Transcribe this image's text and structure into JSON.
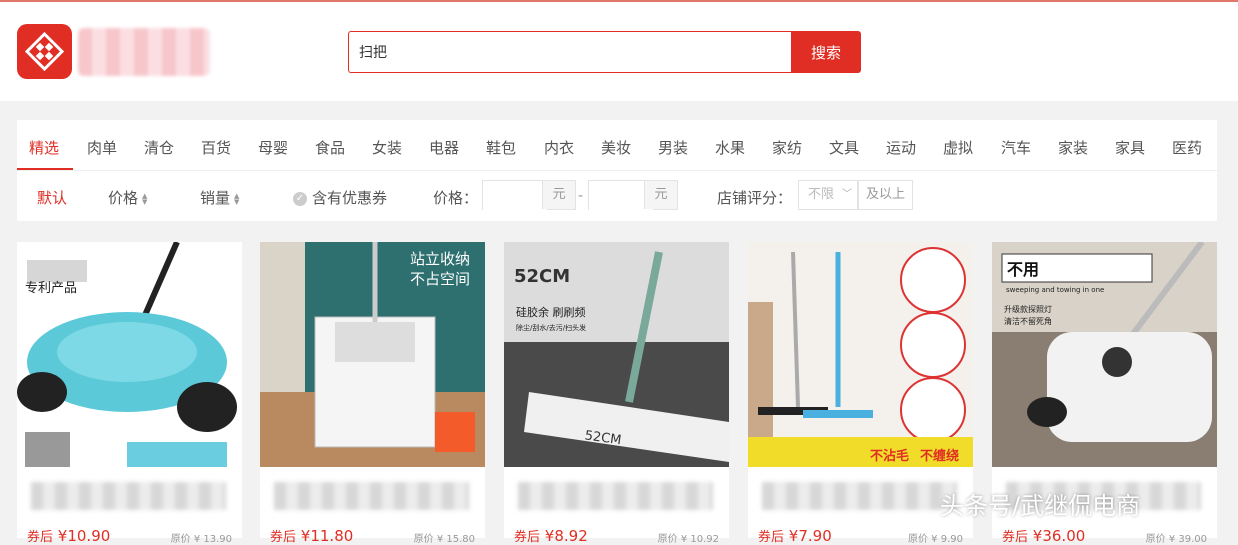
{
  "search": {
    "value": "扫把",
    "button": "搜索"
  },
  "categories": [
    "精选",
    "肉单",
    "清仓",
    "百货",
    "母婴",
    "食品",
    "女装",
    "电器",
    "鞋包",
    "内衣",
    "美妆",
    "男装",
    "水果",
    "家纺",
    "文具",
    "运动",
    "虚拟",
    "汽车",
    "家装",
    "家具",
    "医药"
  ],
  "filters": {
    "default": "默认",
    "price_sort": "价格",
    "sales_sort": "销量",
    "coupon": "含有优惠券",
    "price_label": "价格：",
    "unit": "元",
    "dash": "-",
    "shop_score_label": "店铺评分：",
    "shop_score_value": "不限",
    "and_above": "及以上"
  },
  "products": [
    {
      "img_text1": "专利产品",
      "price_prefix": "券后",
      "price": "¥10.90",
      "orig": "原价 ¥ 13.90"
    },
    {
      "img_text1": "站立收纳",
      "img_text2": "不占空间",
      "price_prefix": "券后",
      "price": "¥11.80",
      "orig": "原价 ¥ 15.80"
    },
    {
      "img_text1": "52CM",
      "img_text2": "硅胶余 刷刷频",
      "img_text3": "除尘/刮水/去污/扫头发",
      "img_text4": "52CM",
      "price_prefix": "券后",
      "price": "¥8.92",
      "orig": "原价 ¥ 10.92"
    },
    {
      "img_text1": "不沾毛",
      "img_text2": "不缠绕",
      "price_prefix": "券后",
      "price": "¥7.90",
      "orig": "原价 ¥ 9.90"
    },
    {
      "img_text1": "不用",
      "img_text2": "sweeping and towing in one",
      "img_text3": "升级款探照灯",
      "img_text4": "清洁不留死角",
      "price_prefix": "券后",
      "price": "¥36.00",
      "orig": "原价 ¥ 39.00"
    }
  ],
  "watermark": "头条号/武继侃电商",
  "colors": {
    "brand": "#e02e24"
  }
}
